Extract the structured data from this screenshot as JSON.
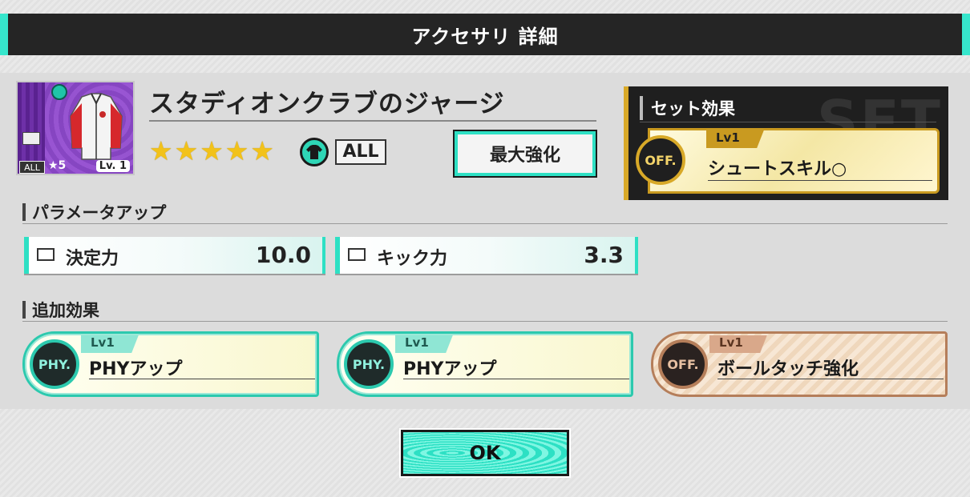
{
  "dialog": {
    "title": "アクセサリ 詳細"
  },
  "item": {
    "name": "スタディオンクラブのジャージ",
    "rarity_label": "★5",
    "level_label": "Lv. 1",
    "card_tag": "ALL",
    "stars": 5,
    "type_tag": "ALL",
    "accent_color": "#2ee0c4"
  },
  "buttons": {
    "max_enhance": "最大強化",
    "ok": "OK"
  },
  "set_effect": {
    "header": "セット効果",
    "watermark": "SET",
    "level": "Lv1",
    "badge": "OFF.",
    "name": "シュートスキル○",
    "color": "#c99a20"
  },
  "param_section": {
    "header": "パラメータアップ",
    "items": [
      {
        "label": "決定力",
        "value": "10.0"
      },
      {
        "label": "キック力",
        "value": "3.3"
      }
    ]
  },
  "additional_section": {
    "header": "追加効果",
    "items": [
      {
        "level": "Lv1",
        "badge": "PHY.",
        "label": "PHYアップ",
        "style": "green"
      },
      {
        "level": "Lv1",
        "badge": "PHY.",
        "label": "PHYアップ",
        "style": "green"
      },
      {
        "level": "Lv1",
        "badge": "OFF.",
        "label": "ボールタッチ強化",
        "style": "bronze"
      }
    ]
  }
}
